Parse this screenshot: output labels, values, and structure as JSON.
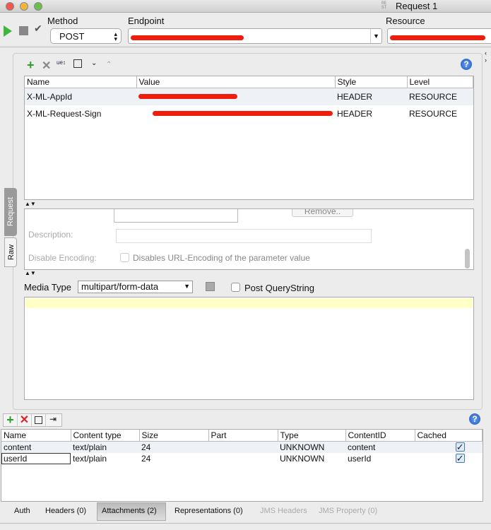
{
  "window": {
    "title": "Request 1",
    "rest_icon": "RE ST"
  },
  "toolbar": {
    "method_label": "Method",
    "method_value": "POST",
    "endpoint_label": "Endpoint",
    "resource_label": "Resource"
  },
  "params": {
    "columns": [
      "Name",
      "Value",
      "Style",
      "Level"
    ],
    "rows": [
      {
        "name": "X-ML-AppId",
        "style": "HEADER",
        "level": "RESOURCE"
      },
      {
        "name": "X-ML-Request-Sign",
        "style": "HEADER",
        "level": "RESOURCE"
      }
    ],
    "remove_label": "Remove..",
    "description_label": "Description:",
    "disable_encoding_label": "Disable Encoding:",
    "disable_encoding_text": "Disables URL-Encoding of the parameter value"
  },
  "side_tabs": {
    "request": "Request",
    "raw": "Raw"
  },
  "media": {
    "label": "Media Type",
    "value": "multipart/form-data",
    "post_querystring": "Post QueryString"
  },
  "attachments": {
    "columns": [
      "Name",
      "Content type",
      "Size",
      "Part",
      "Type",
      "ContentID",
      "Cached"
    ],
    "rows": [
      {
        "name": "content",
        "ctype": "text/plain",
        "size": "24",
        "part": "",
        "type": "UNKNOWN",
        "cid": "content",
        "cached": true
      },
      {
        "name": "userId",
        "ctype": "text/plain",
        "size": "24",
        "part": "",
        "type": "UNKNOWN",
        "cid": "userId",
        "cached": true
      }
    ]
  },
  "bottom_tabs": [
    "Auth",
    "Headers (0)",
    "Attachments (2)",
    "Representations (0)",
    "JMS Headers",
    "JMS Property (0)"
  ],
  "colors": {
    "accent_red": "#f01c0c",
    "editor_bg": "#ffffc8"
  }
}
